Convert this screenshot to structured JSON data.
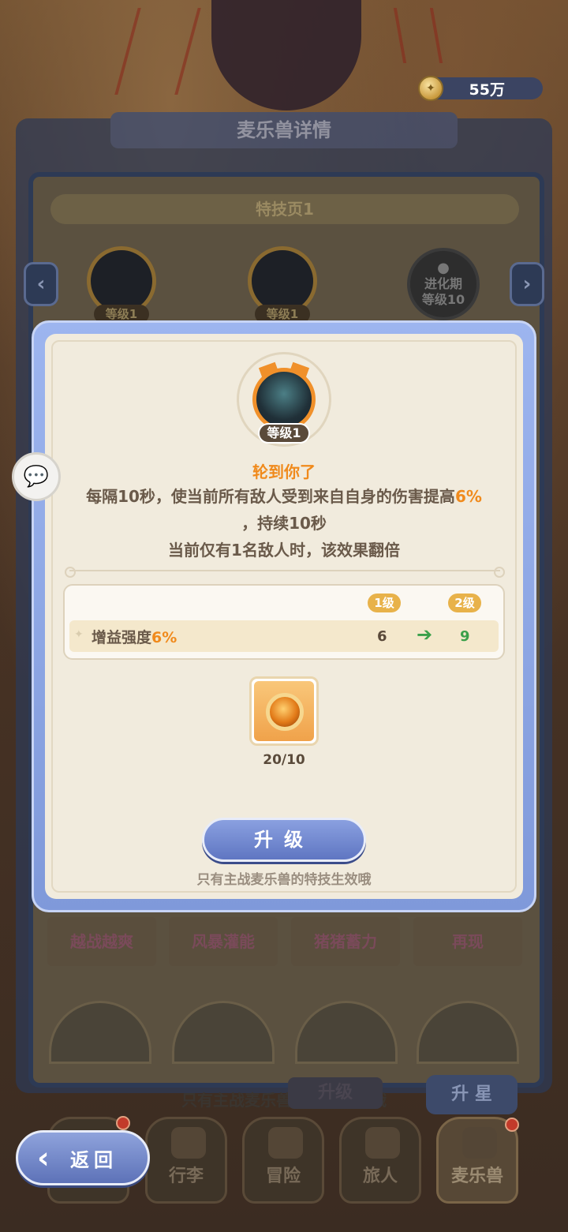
{
  "currency": {
    "icon": "coin-icon",
    "amount": "55万"
  },
  "background_panel": {
    "title": "麦乐兽详情",
    "page_label": "特技页1",
    "skill_slots": [
      {
        "level_label": "等级1"
      },
      {
        "level_label": "等级1"
      },
      {
        "locked_line1": "进化期",
        "locked_line2": "等级10"
      }
    ],
    "skill_tabs": [
      "越战越爽",
      "风暴灌能",
      "猪猪蓄力",
      "再现"
    ],
    "hint": "只有主战麦乐兽的特技生效哦",
    "upgrade_label": "升级",
    "star_label": "升 星"
  },
  "modal": {
    "level_label": "等级1",
    "skill_name": "轮到你了",
    "desc_line1_a": "每隔10秒，使当前所有敌人受到来自自身的伤害提高",
    "desc_line1_hl": "6%",
    "desc_line2": "，持续10秒",
    "desc_line3": "当前仅有1名敌人时，该效果翻倍",
    "stats": {
      "from_level": "1级",
      "to_level": "2级",
      "label_a": "增益强度",
      "label_hl": "6%",
      "from_value": "6",
      "to_value": "9"
    },
    "material": {
      "count": "20/10"
    },
    "upgrade_button": "升级",
    "hint": "只有主战麦乐兽的特技生效哦"
  },
  "bottom_nav": {
    "back_label": "返回",
    "tabs": [
      "行李",
      "冒险",
      "旅人",
      "麦乐兽"
    ]
  },
  "colors": {
    "accent": "#f08a1c",
    "button": "#6f86cf",
    "success": "#3aa04a"
  }
}
